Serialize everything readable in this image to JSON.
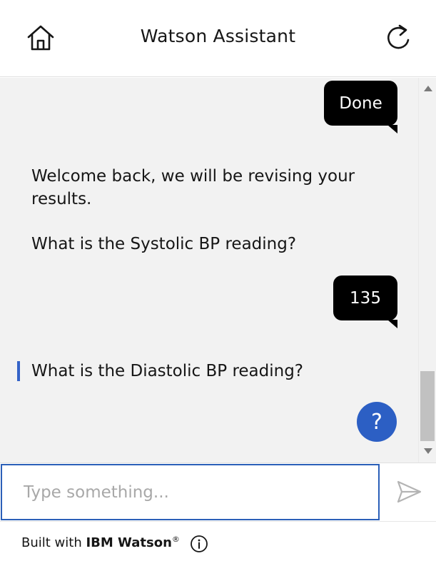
{
  "header": {
    "title": "Watson Assistant",
    "home_icon": "home-icon",
    "restart_icon": "restart-icon"
  },
  "messages": {
    "user_done": "Done",
    "bot_welcome": "Welcome back, we will be revising your results.",
    "bot_systolic": "What is the Systolic BP reading?",
    "user_135": "135",
    "bot_diastolic": "What is the Diastolic BP reading?"
  },
  "help_button": {
    "label": "?"
  },
  "input": {
    "placeholder": "Type something...",
    "value": "",
    "send_icon": "send-icon"
  },
  "footer": {
    "prefix": "Built with ",
    "brand": "IBM Watson",
    "registered": "®",
    "info_icon": "info-icon"
  },
  "colors": {
    "accent": "#2c5fc4",
    "bubble": "#000000",
    "message_bg": "#f2f2f2",
    "input_border": "#2b5fb8"
  }
}
